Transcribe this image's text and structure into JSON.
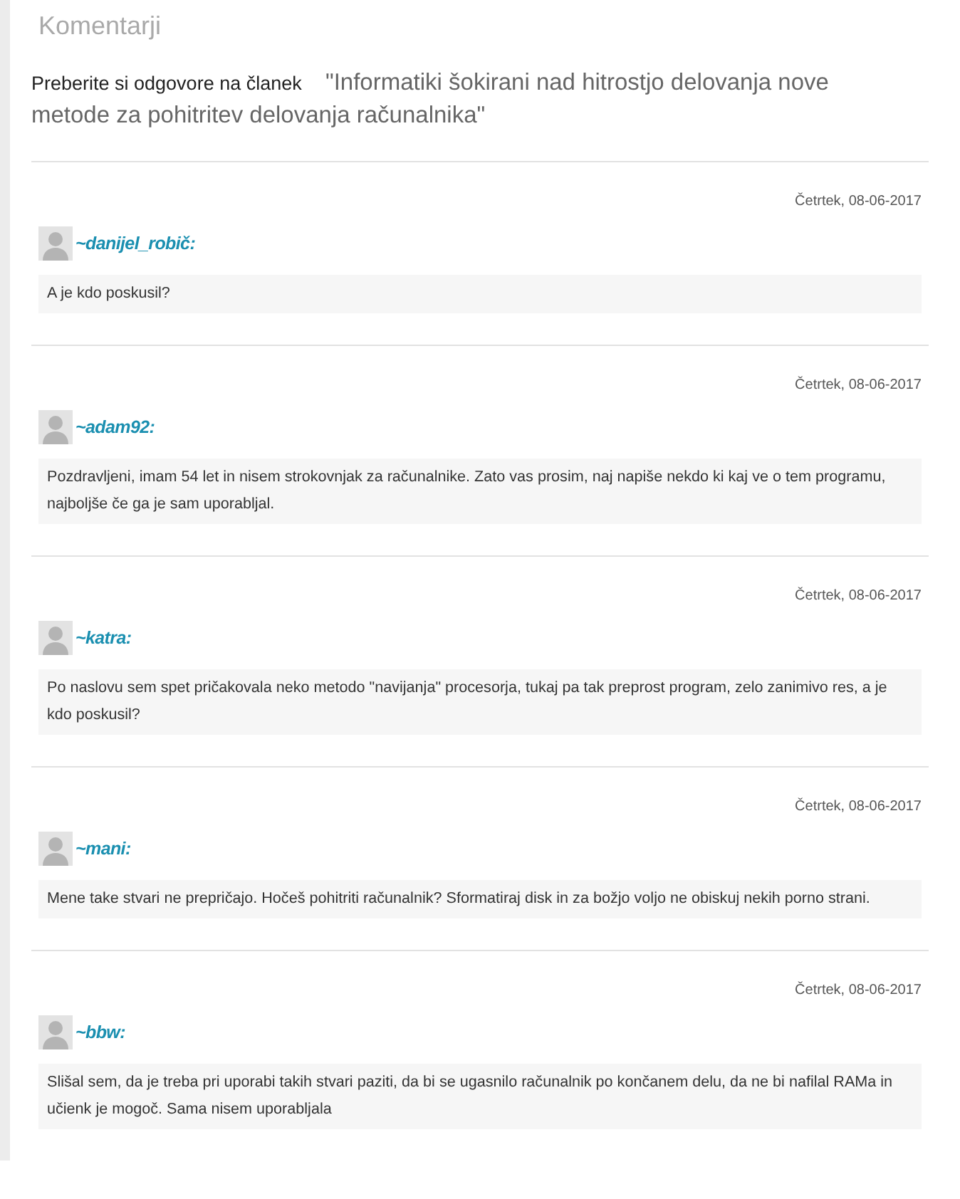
{
  "heading": "Komentarji",
  "intro": {
    "label": "Preberite si odgovore na članek",
    "article_title": "\"Informatiki šokirani nad hitrostjo delovanja nove metode za pohitritev delovanja računalnika\""
  },
  "comments": [
    {
      "date": "Četrtek, 08-06-2017",
      "author": "~danijel_robič:",
      "text": "A je kdo poskusil?"
    },
    {
      "date": "Četrtek, 08-06-2017",
      "author": "~adam92:",
      "text": "Pozdravljeni, imam 54 let in nisem strokovnjak za računalnike. Zato vas prosim, naj napiše nekdo ki kaj ve o tem programu, najboljše če ga je sam uporabljal."
    },
    {
      "date": "Četrtek, 08-06-2017",
      "author": "~katra:",
      "text": "Po naslovu sem spet pričakovala neko metodo \"navijanja\" procesorja, tukaj pa tak preprost program, zelo zanimivo res, a je kdo poskusil?"
    },
    {
      "date": "Četrtek, 08-06-2017",
      "author": "~mani:",
      "text": "Mene take stvari ne prepričajo. Hočeš pohitriti računalnik? Sformatiraj disk in za božjo voljo ne obiskuj nekih porno strani."
    },
    {
      "date": "Četrtek, 08-06-2017",
      "author": "~bbw:",
      "text": "Slišal sem, da je treba pri uporabi takih stvari paziti, da bi se ugasnilo računalnik po končanem delu, da ne bi nafilal RAMa in učienk je mogoč. Sama nisem uporabljala"
    }
  ]
}
